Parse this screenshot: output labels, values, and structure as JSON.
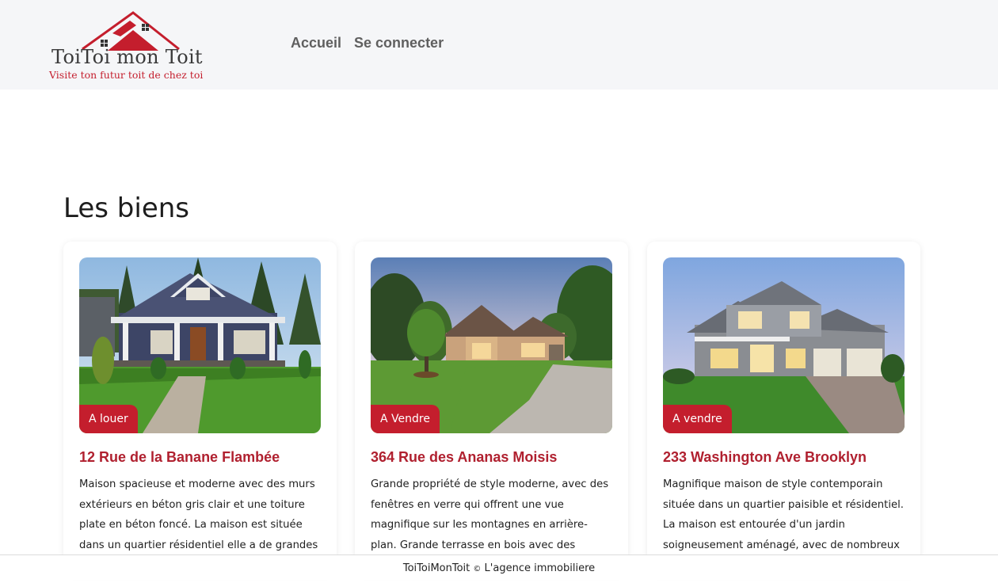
{
  "brand": {
    "title": "ToiToi mon Toit",
    "tagline": "Visite ton futur toit de chez toi",
    "accent": "#c41e2d"
  },
  "nav": {
    "home": "Accueil",
    "login": "Se connecter"
  },
  "section": {
    "title": "Les biens"
  },
  "cards": [
    {
      "badge": "A louer",
      "title": "12 Rue de la Banane Flambée",
      "text": "Maison spacieuse et moderne avec des murs extérieurs en béton gris clair et une toiture plate en béton foncé. La maison est située dans un quartier résidentiel elle a de grandes"
    },
    {
      "badge": "A Vendre",
      "title": "364 Rue des Ananas Moisis",
      "text": "Grande propriété de style moderne, avec des fenêtres en verre qui offrent une vue magnifique sur les montagnes en arrière-plan. Grande terrasse en bois avec des chaises et"
    },
    {
      "badge": "A vendre",
      "title": "233 Washington Ave Brooklyn",
      "text": "Magnifique maison de style contemporain située dans un quartier paisible et résidentiel. La maison est entourée d'un jardin soigneusement aménagé, avec de nombreux"
    }
  ],
  "footer": {
    "brand": "ToiToiMonToit",
    "copyright": "©",
    "agency": "L'agence immobiliere"
  }
}
